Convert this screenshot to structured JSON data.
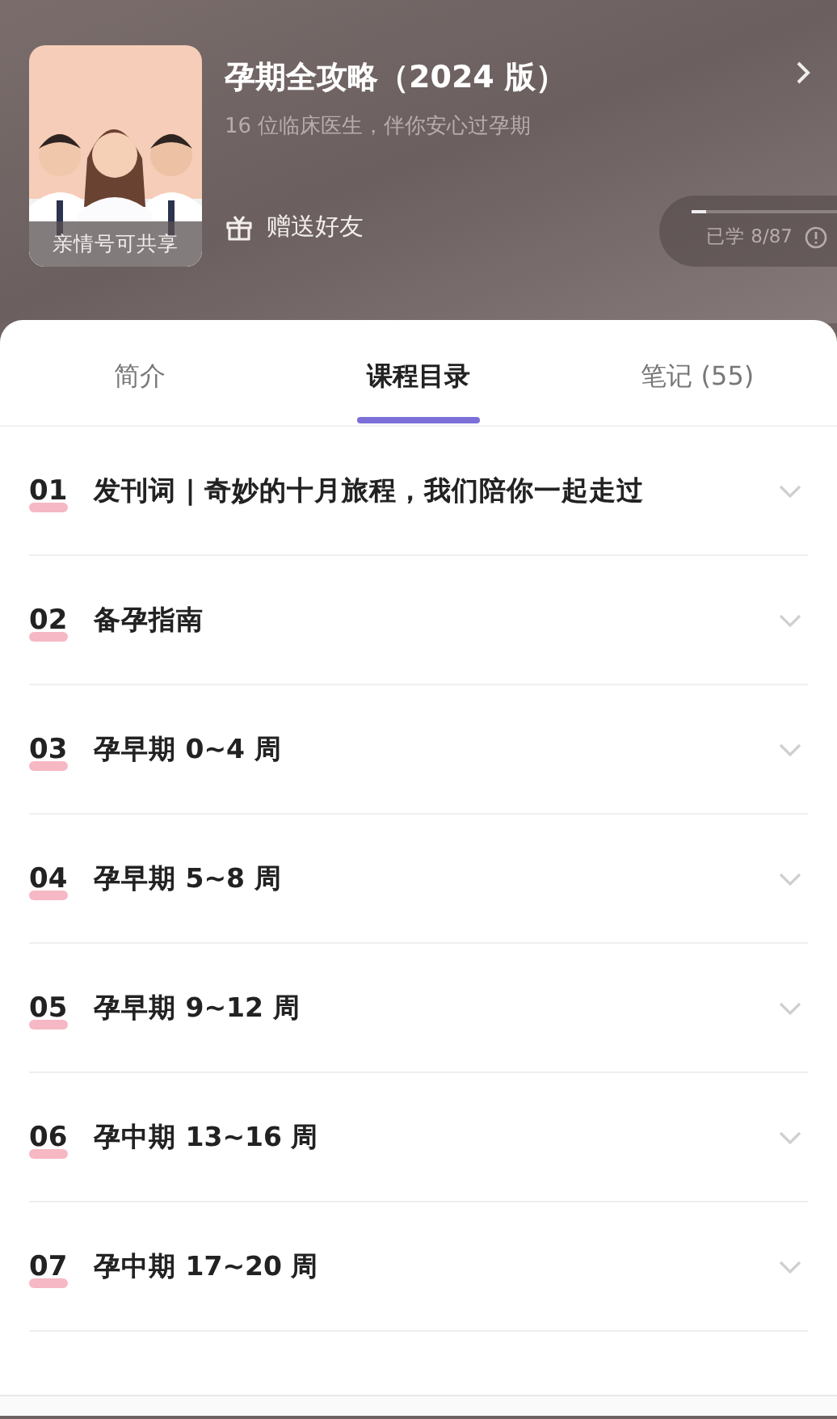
{
  "course": {
    "cover_caption": "亲情号可共享",
    "title": "孕期全攻略（2024 版）",
    "subtitle": "16 位临床医生，伴你安心过孕期",
    "gift": "赠送好友",
    "progress": {
      "text": "已学 8/87",
      "level": 0.09
    }
  },
  "tabs": [
    {
      "label": "简介",
      "selected": false
    },
    {
      "label": "课程目录",
      "selected": true
    },
    {
      "label": "笔记 (55)",
      "selected": false
    }
  ],
  "lessons": [
    {
      "number": "01",
      "title": "发刊词 | 奇妙的十月旅程，我们陪你一起走过",
      "expanded": false
    },
    {
      "number": "02",
      "title": "备孕指南",
      "expanded": false
    },
    {
      "number": "03",
      "title": "孕早期 0~4 周",
      "expanded": false
    },
    {
      "number": "04",
      "title": "孕早期 5~8 周",
      "expanded": false
    },
    {
      "number": "05",
      "title": "孕早期 9~12 周",
      "expanded": false
    },
    {
      "number": "06",
      "title": "孕中期 13~16 周",
      "expanded": false
    },
    {
      "number": "07",
      "title": "孕中期 17~20 周",
      "expanded": false
    }
  ]
}
